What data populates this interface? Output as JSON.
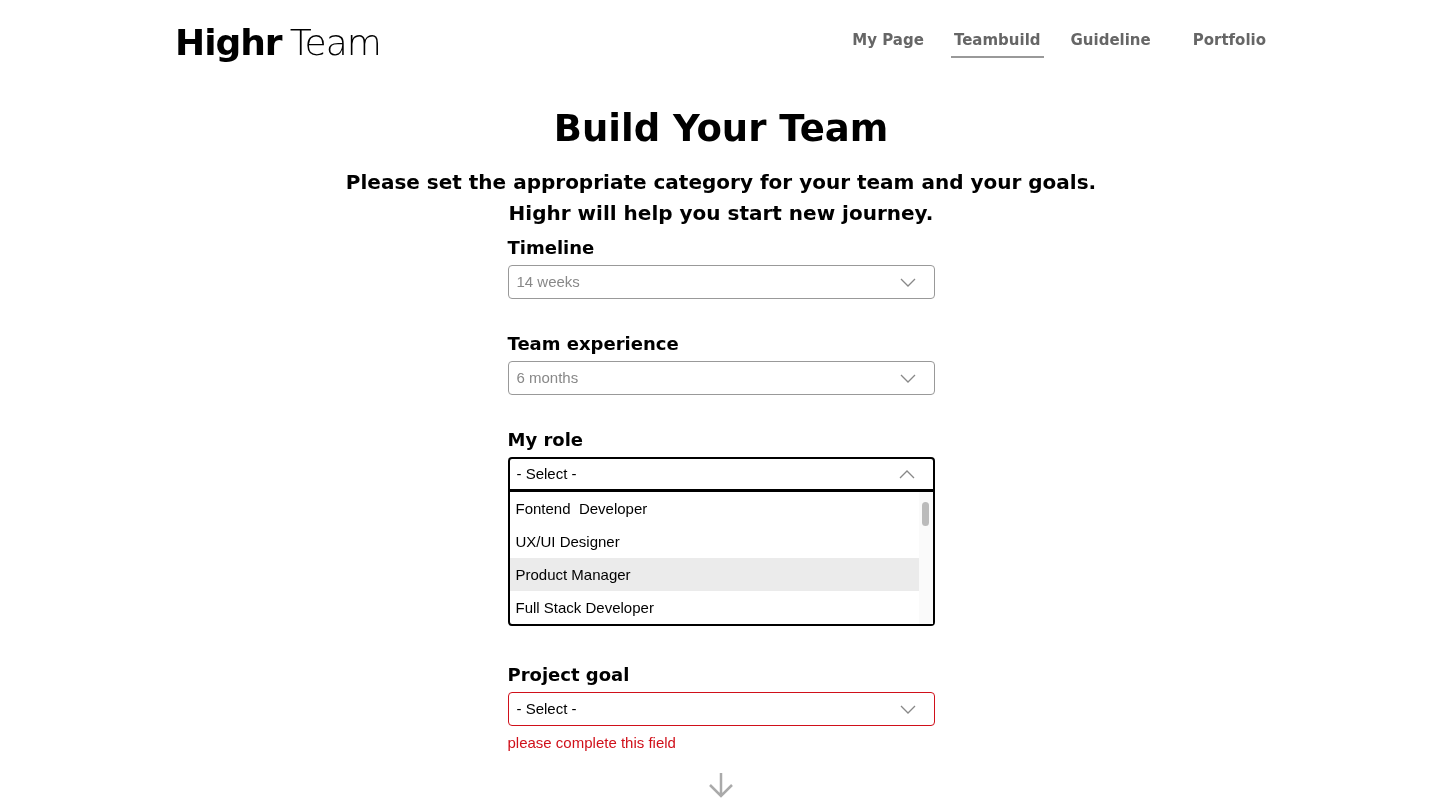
{
  "logo": {
    "bold": "Highr",
    "light": "Team"
  },
  "nav": [
    {
      "label": "My Page",
      "selected": false
    },
    {
      "label": "Teambuild",
      "selected": true
    },
    {
      "label": "Guideline",
      "selected": false
    },
    {
      "label": "Portfolio",
      "selected": false
    }
  ],
  "title": "Build Your Team",
  "subtitle": [
    "Please set the appropriate category for your team and your goals.",
    "Highr will help you start new journey."
  ],
  "fields": [
    {
      "label": "Timeline",
      "value": "14 weeks",
      "muted": true,
      "expanded": false,
      "invalid": false
    },
    {
      "label": "Team experience",
      "value": "6 months",
      "muted": true,
      "expanded": false,
      "invalid": false
    },
    {
      "label": "My role",
      "value": "- Select -",
      "muted": false,
      "expanded": true,
      "invalid": false,
      "options": [
        {
          "label": "Fontend  Developer",
          "selected": false
        },
        {
          "label": "UX/UI Designer",
          "selected": false
        },
        {
          "label": "Product Manager",
          "selected": true
        },
        {
          "label": "Full Stack Developer",
          "selected": false
        }
      ]
    },
    {
      "label": "Project goal",
      "value": "- Select -",
      "muted": false,
      "expanded": false,
      "invalid": true,
      "error": "please complete this field"
    }
  ]
}
